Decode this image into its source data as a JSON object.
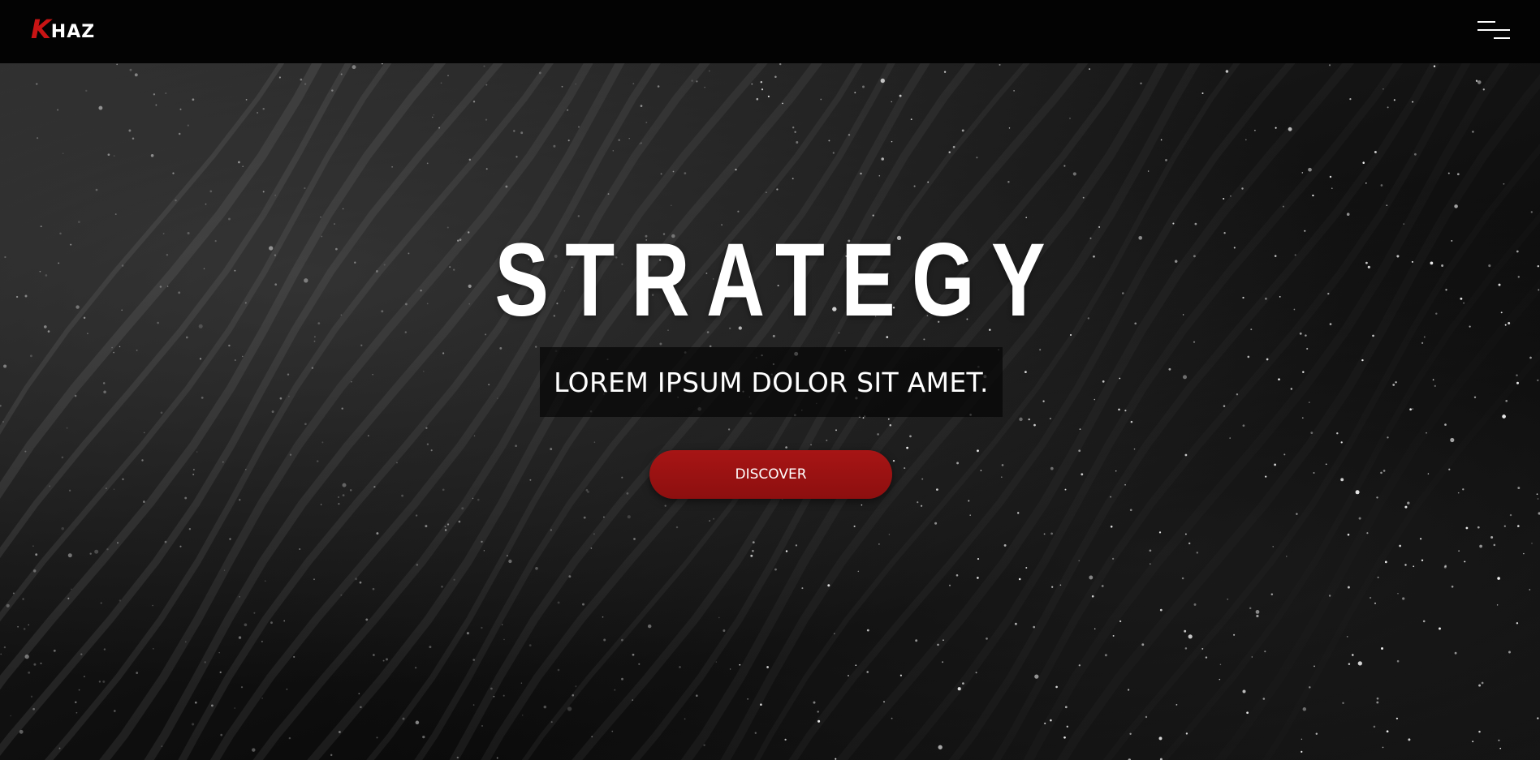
{
  "header": {
    "logo": {
      "first_letter": "K",
      "rest": "HAZ"
    },
    "menu_icon": "hamburger-menu-icon"
  },
  "hero": {
    "title": "STRATEGY",
    "subtitle": "LOREM IPSUM DOLOR SIT AMET.",
    "cta_label": "DISCOVER",
    "background": "dark-sand-dunes-texture"
  },
  "colors": {
    "accent": "#c91414",
    "button": "#9b1212",
    "header_bg": "#030303",
    "text": "#ffffff"
  }
}
